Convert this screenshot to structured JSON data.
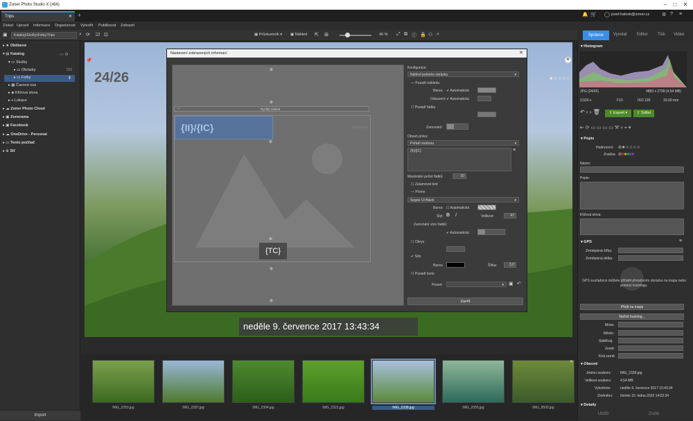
{
  "app": {
    "title": "Zoner Photo Studio X (x64)"
  },
  "tab": {
    "label": "Trips"
  },
  "menu": [
    "Získat",
    "Upravit",
    "Informace",
    "Organizovat",
    "Vytvořit",
    "Publikovat",
    "Zobrazit"
  ],
  "header_right": {
    "user": "josef.halcok@zoner.cz"
  },
  "toolbar": {
    "path": "Katalog\\Složky\\Fotky\\Trips",
    "browser": "Průzkumník",
    "preview": "Náhled",
    "zoom": "46 %"
  },
  "modules": [
    "Správce",
    "Vyvolat",
    "Editor",
    "Tisk",
    "Video"
  ],
  "nav": {
    "items": [
      {
        "label": "Oblíbené",
        "bold": true
      },
      {
        "label": "Katalog",
        "bold": true
      },
      {
        "label": "Složky"
      },
      {
        "label": "Obrázky",
        "count": "531"
      },
      {
        "label": "Fotky"
      },
      {
        "label": "Časová osa"
      },
      {
        "label": "Klíčová slova"
      },
      {
        "label": "Lokace"
      },
      {
        "label": "Zoner Photo Cloud",
        "bold": true
      },
      {
        "label": "Zonerama",
        "bold": true
      },
      {
        "label": "Facebook",
        "bold": true
      },
      {
        "label": "OneDrive - Personal",
        "bold": true
      },
      {
        "label": "Tento počítač",
        "bold": true
      },
      {
        "label": "Síť",
        "bold": true
      }
    ],
    "import": "Import"
  },
  "viewer": {
    "counter": "24/26",
    "caption": "neděle 9. července 2017 13:43:34"
  },
  "dialog": {
    "title": "Nastavení zobrazených informací",
    "preview": {
      "top_tag": "{II}/{IC}",
      "bottom_tag": "{TC}",
      "quick_label": "Rychlý náhled"
    },
    "config": {
      "section": "Konfigurace",
      "mode": "Náhled jednoho obrázku",
      "bg_preview": "Pozadí náhledu",
      "color_lbl": "Barva:",
      "auto_lbl": "Automatická",
      "shade_lbl": "Odsazení:",
      "bg_row": "Pozadí řádku",
      "align_lbl": "Zarovnání:",
      "content_lbl": "Obsah prvku:",
      "content_sel": "Pořadí souboru",
      "content_val": "{II}/{IC}",
      "maxrows_lbl": "Maximální počet řádků:",
      "maxrows_val": "10",
      "wrap_lbl": "Zalamovat text",
      "font_lbl": "Písmo",
      "font_sel": "Segoe UI Black",
      "style_lbl": "Styl:",
      "size_lbl": "Velikost:",
      "size_val": "47",
      "multiline_lbl": "Zarovnání více řádků:",
      "outline_lbl": "Obrys",
      "shadow_lbl": "Stín",
      "width_lbl": "Šířka:",
      "width_val": "3,0",
      "textbg_lbl": "Pozadí textu",
      "preset_lbl": "Preset:",
      "close_btn": "Zavřít"
    }
  },
  "right": {
    "histogram": "Histogram",
    "file_info": {
      "format": "JPG (24/26)",
      "dims": "4850 x 2728 (4,54 MB)",
      "shutter": "1/320 s",
      "fnum": "F10",
      "iso": "ISO 100",
      "focal": "33.00 mm"
    },
    "export_btn": "Export",
    "share_btn": "Sdílet",
    "desc": {
      "title": "Popis",
      "rating": "Hodnocení:",
      "label": "Značka:",
      "name": "Název:",
      "caption": "Popis:",
      "keywords": "Klíčová slova:"
    },
    "gps": {
      "title": "GPS",
      "lat": "Zeměpisná šířka:",
      "lon": "Zeměpisná délka:",
      "hint": "GPS souřadnice můžete přiřadit přetažením obrázku na mapu nebo pomocí tracklogu.",
      "map_btn": "Přejít na mapu",
      "track_btn": "Načíst tracklog...",
      "place": "Místo:",
      "city": "Město:",
      "country": "Stát/Kraj:",
      "land": "Země:",
      "code": "Kód země:"
    },
    "general": {
      "title": "Obecné",
      "filename_lbl": "Jméno souboru:",
      "filename": "IMG_2338.jpg",
      "size_lbl": "Velikost souboru:",
      "size": "4.54 MB",
      "created_lbl": "Vytvořeno:",
      "created": "neděle 9. července 2017 13:43:34",
      "modified_lbl": "Změněno:",
      "modified": "čtvrtek 10. ledna 2022 14:02:34"
    },
    "details": "Detaily",
    "save_btn": "Uložit",
    "reset_btn": "Zrušit"
  },
  "filmstrip": [
    {
      "name": "IMG_2253.jpg",
      "c1": "#7aa04a",
      "c2": "#3d6a22"
    },
    {
      "name": "IMG_2287.jpg",
      "c1": "#98b7d8",
      "c2": "#4e7a2e"
    },
    {
      "name": "IMG_2304.jpg",
      "c1": "#4d8a2e",
      "c2": "#2c5e1a"
    },
    {
      "name": "IMG_2321.jpg",
      "c1": "#5ea02e",
      "c2": "#3a7a1a"
    },
    {
      "name": "IMG_2338.jpg",
      "c1": "#a9c0dc",
      "c2": "#5a8a3a",
      "selected": true
    },
    {
      "name": "IMG_2355.jpg",
      "c1": "#8fb79a",
      "c2": "#2e6a5a"
    },
    {
      "name": "IMG_9500.jpg",
      "c1": "#6e8a3a",
      "c2": "#3c5a2a"
    }
  ]
}
